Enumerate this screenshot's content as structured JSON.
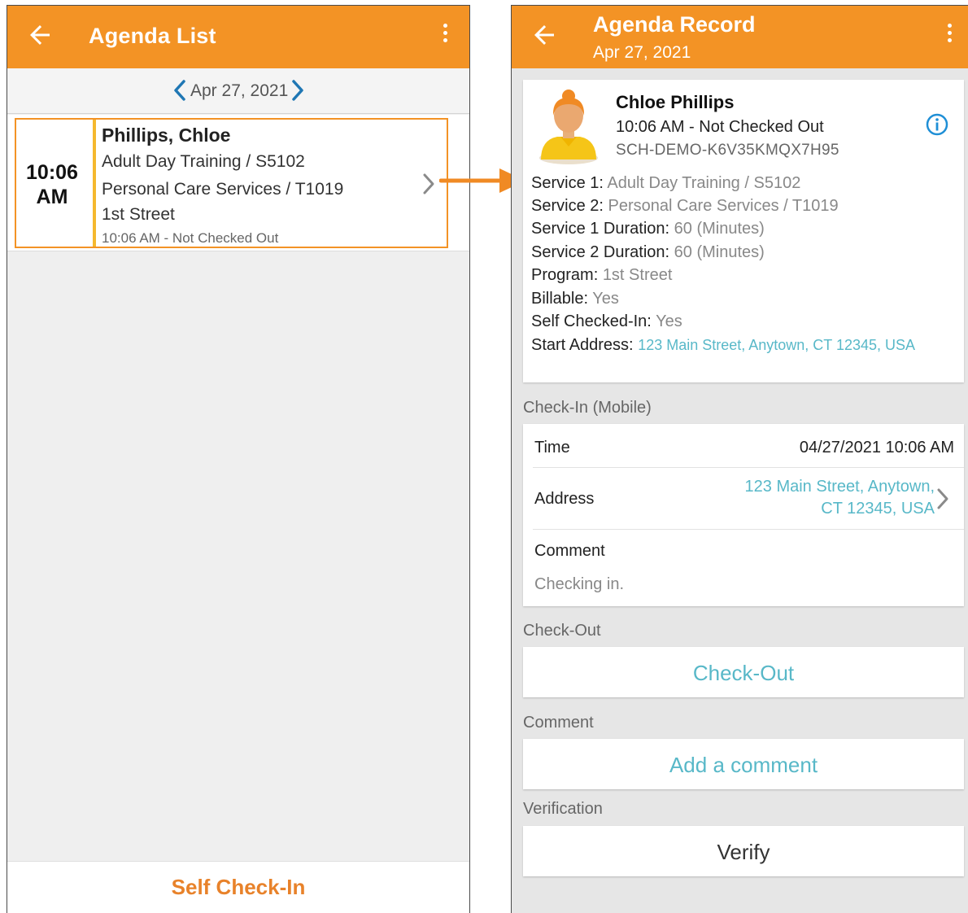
{
  "left": {
    "title": "Agenda List",
    "date": "Apr 27, 2021",
    "card": {
      "time": "10:06 AM",
      "name": "Phillips, Chloe",
      "service1": "Adult Day Training / S5102",
      "service2": "Personal Care Services / T1019",
      "program": "1st Street",
      "status": "10:06 AM - Not Checked Out"
    },
    "self_checkin_label": "Self Check-In"
  },
  "right": {
    "title": "Agenda Record",
    "subtitle": "Apr 27, 2021",
    "profile": {
      "name": "Chloe Phillips",
      "status": "10:06 AM - Not Checked Out",
      "id": "SCH-DEMO-K6V35KMQX7H95"
    },
    "fields": [
      {
        "label": "Service 1:",
        "value": "Adult Day Training / S5102"
      },
      {
        "label": "Service 2:",
        "value": "Personal Care Services / T1019"
      },
      {
        "label": "Service 1 Duration:",
        "value": "60 (Minutes)"
      },
      {
        "label": "Service 2 Duration:",
        "value": "60 (Minutes)"
      },
      {
        "label": "Program:",
        "value": "1st Street"
      },
      {
        "label": "Billable:",
        "value": "Yes"
      },
      {
        "label": "Self Checked-In:",
        "value": "Yes"
      },
      {
        "label": "Start Address:",
        "value": "123 Main Street, Anytown, CT 12345, USA"
      }
    ],
    "checkin": {
      "section": "Check-In (Mobile)",
      "time_label": "Time",
      "time_value": "04/27/2021 10:06 AM",
      "address_label": "Address",
      "address_value": "123 Main Street, Anytown, CT 12345, USA",
      "comment_label": "Comment",
      "comment_value": "Checking in."
    },
    "checkout": {
      "section": "Check-Out",
      "button": "Check-Out"
    },
    "comment": {
      "section": "Comment",
      "button": "Add a comment"
    },
    "verification": {
      "section": "Verification",
      "button": "Verify"
    }
  },
  "colors": {
    "appbar": "#f39325",
    "accent_bar": "#f5b82e",
    "link": "#58b8c8",
    "nav_chevron": "#1f77b4",
    "self_checkin": "#e8822a"
  },
  "icons": {
    "back": "arrow-left-icon",
    "menu": "more-vertical-icon",
    "info": "info-circle-icon",
    "chevron": "chevron-right-icon",
    "avatar": "person-avatar-icon"
  }
}
